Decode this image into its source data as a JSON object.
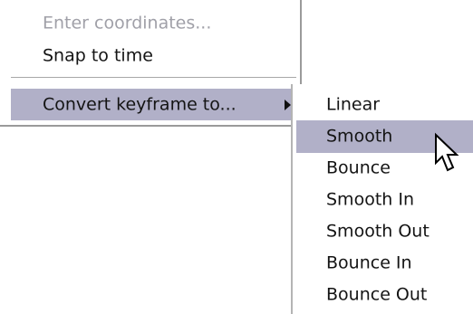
{
  "main_menu": {
    "items": [
      {
        "label": "Enter coordinates...",
        "enabled": false
      },
      {
        "label": "Snap to time",
        "enabled": true
      },
      {
        "label": "Convert keyframe to...",
        "enabled": true,
        "has_submenu": true,
        "highlighted": true
      }
    ]
  },
  "submenu": {
    "items": [
      {
        "label": "Linear"
      },
      {
        "label": "Smooth",
        "highlighted": true
      },
      {
        "label": "Bounce"
      },
      {
        "label": "Smooth In"
      },
      {
        "label": "Smooth Out"
      },
      {
        "label": "Bounce In"
      },
      {
        "label": "Bounce Out"
      }
    ]
  },
  "colors": {
    "highlight": "#b1b0c8",
    "text": "#141414",
    "disabled_text": "#a0a0a8"
  },
  "icons": {
    "submenu_arrow": "triangle-right-icon",
    "cursor": "arrow-cursor-icon"
  }
}
